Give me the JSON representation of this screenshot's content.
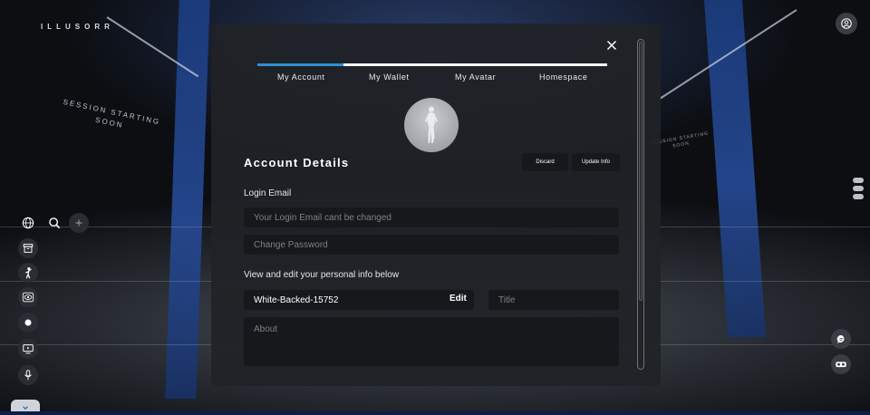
{
  "scene": {
    "logo": "ILLUSORR",
    "session_line1": "SESSION STARTING",
    "session_line2": "SOON",
    "session_right_line1": "SESSION STARTING",
    "session_right_line2": "SOON"
  },
  "left_toolbar": {
    "icons": [
      "globe-icon",
      "search-icon",
      "plus-icon",
      "archive-icon",
      "avatar-wave-icon",
      "eye-frame-icon",
      "record-icon",
      "screen-share-icon",
      "microphone-icon",
      "chevron-down-icon"
    ]
  },
  "right_toolbar": {
    "icons": [
      "profile-icon",
      "more-dots-icon",
      "chat-icon",
      "vr-headset-icon"
    ]
  },
  "modal": {
    "tabs": [
      {
        "label": "My Account",
        "active": true
      },
      {
        "label": "My Wallet",
        "active": false
      },
      {
        "label": "My Avatar",
        "active": false
      },
      {
        "label": "Homespace",
        "active": false
      }
    ],
    "section_title": "Account Details",
    "discard_label": "Discard",
    "update_label": "Update Info",
    "login_email_label": "Login Email",
    "login_email_placeholder": "Your Login Email cant be changed",
    "change_password_placeholder": "Change Password",
    "personal_info_label": "View and edit your personal info below",
    "display_name": "White-Backed-15752",
    "edit_label": "Edit",
    "title_placeholder": "Title",
    "about_placeholder": "About"
  },
  "colors": {
    "accent": "#2f8fd8",
    "modal_bg": "#202226",
    "field_bg": "#17181b",
    "pillar_blue": "#274e9e"
  }
}
